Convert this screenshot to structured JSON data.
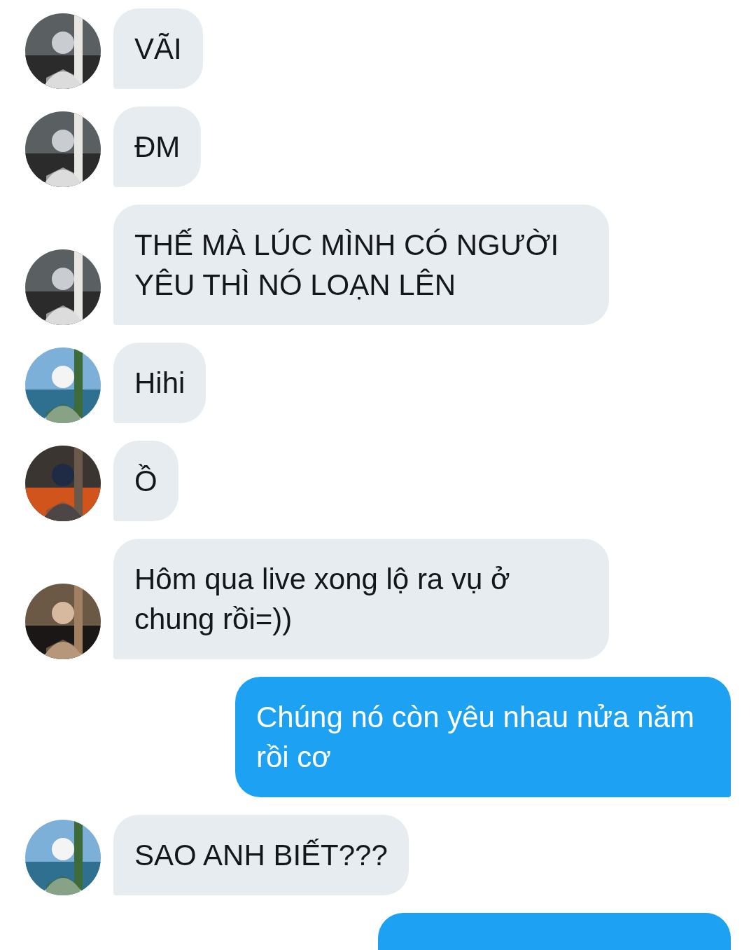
{
  "messages": [
    {
      "kind": "incoming",
      "text": "VÃI"
    },
    {
      "kind": "incoming",
      "text": "ĐM"
    },
    {
      "kind": "incoming",
      "text": "THẾ MÀ LÚC MÌNH CÓ NGƯỜI YÊU THÌ NÓ LOẠN LÊN"
    },
    {
      "kind": "incoming",
      "text": "Hihi"
    },
    {
      "kind": "incoming",
      "text": "Ồ"
    },
    {
      "kind": "incoming",
      "text": "Hôm qua live xong lộ ra vụ ở chung rồi=))"
    },
    {
      "kind": "outgoing",
      "text": "Chúng nó còn yêu nhau nửa năm rồi cơ"
    },
    {
      "kind": "incoming",
      "text": "SAO ANH BIẾT???"
    },
    {
      "kind": "outgoing"
    }
  ]
}
